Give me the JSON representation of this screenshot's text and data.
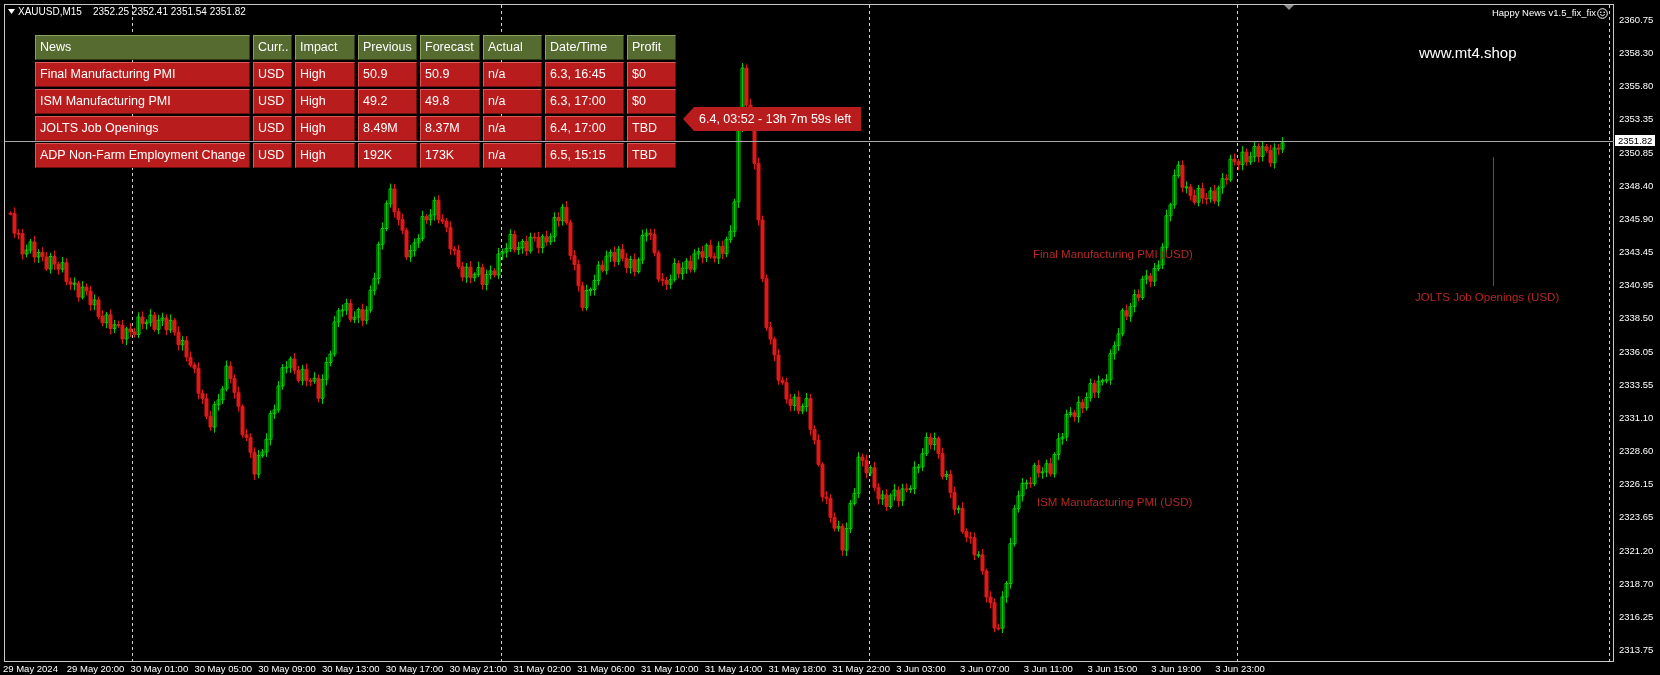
{
  "chart": {
    "symbol": "XAUUSD,M15",
    "quote": "2352.25 2352.41 2351.54 2351.82",
    "indicator": "Happy News v1.5_fix_fix",
    "site_text": "www.mt4.shop"
  },
  "news_table": {
    "columns": [
      "News",
      "Curr..",
      "Impact",
      "Previous",
      "Forecast",
      "Actual",
      "Date/Time",
      "Profit"
    ],
    "rows": [
      {
        "cells": [
          "Final Manufacturing PMI",
          "USD",
          "High",
          "50.9",
          "50.9",
          "n/a",
          "6.3, 16:45",
          "$0"
        ]
      },
      {
        "cells": [
          "ISM Manufacturing PMI",
          "USD",
          "High",
          "49.2",
          "49.8",
          "n/a",
          "6.3, 17:00",
          "$0"
        ]
      },
      {
        "cells": [
          "JOLTS Job Openings",
          "USD",
          "High",
          "8.49M",
          "8.37M",
          "n/a",
          "6.4, 17:00",
          "TBD"
        ]
      },
      {
        "cells": [
          "ADP Non-Farm Employment Change",
          "USD",
          "High",
          "192K",
          "173K",
          "n/a",
          "6.5, 15:15",
          "TBD"
        ]
      }
    ]
  },
  "countdown": "6.4, 03:52 - 13h 7m 59s left",
  "event_labels": [
    {
      "text": "Final Manufacturing PMI (USD)",
      "kind": "label"
    },
    {
      "text": "ISM Manufacturing PMI (USD)",
      "kind": "label"
    },
    {
      "text": "JOLTS Job Openings (USD)",
      "kind": "marker"
    }
  ],
  "price_axis": {
    "labels": [
      "2360.75",
      "2358.30",
      "2355.80",
      "2353.35",
      "2350.85",
      "2348.40",
      "2345.90",
      "2343.45",
      "2340.95",
      "2338.50",
      "2336.05",
      "2333.55",
      "2331.10",
      "2328.60",
      "2326.15",
      "2323.65",
      "2321.20",
      "2318.70",
      "2316.25",
      "2313.75"
    ],
    "current_price": "2351.82"
  },
  "time_axis": {
    "labels": [
      "29 May 2024",
      "29 May 20:00",
      "30 May 01:00",
      "30 May 05:00",
      "30 May 09:00",
      "30 May 13:00",
      "30 May 17:00",
      "30 May 21:00",
      "31 May 02:00",
      "31 May 06:00",
      "31 May 10:00",
      "31 May 14:00",
      "31 May 18:00",
      "31 May 22:00",
      "3 Jun 03:00",
      "3 Jun 07:00",
      "3 Jun 11:00",
      "3 Jun 15:00",
      "3 Jun 19:00",
      "3 Jun 23:00"
    ]
  }
}
